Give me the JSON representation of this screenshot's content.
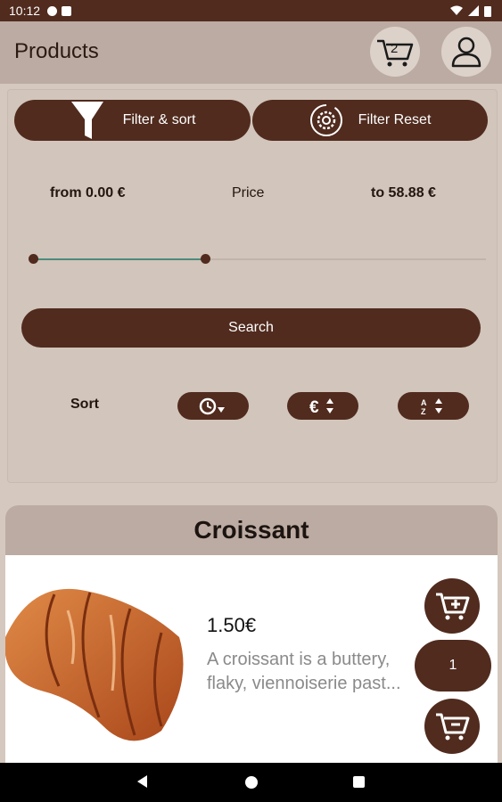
{
  "status_bar": {
    "time": "10:12"
  },
  "app_bar": {
    "title": "Products",
    "cart_count": "2"
  },
  "filter": {
    "filter_sort_label": "Filter & sort",
    "filter_reset_label": "Filter Reset",
    "from_label": "from 0.00 €",
    "price_label": "Price",
    "to_label": "to 58.88 €",
    "range_min_fraction": 0.0,
    "range_max_fraction": 0.38,
    "search_label": "Search",
    "sort_label": "Sort"
  },
  "product": {
    "name": "Croissant",
    "price": "1.50€",
    "description": "A croissant is a buttery, flaky, viennoiserie past...",
    "quantity": "1"
  },
  "colors": {
    "brand_brown": "#502b1e",
    "header_tan": "#bcaba2",
    "slider_green": "#4b8b7b"
  }
}
